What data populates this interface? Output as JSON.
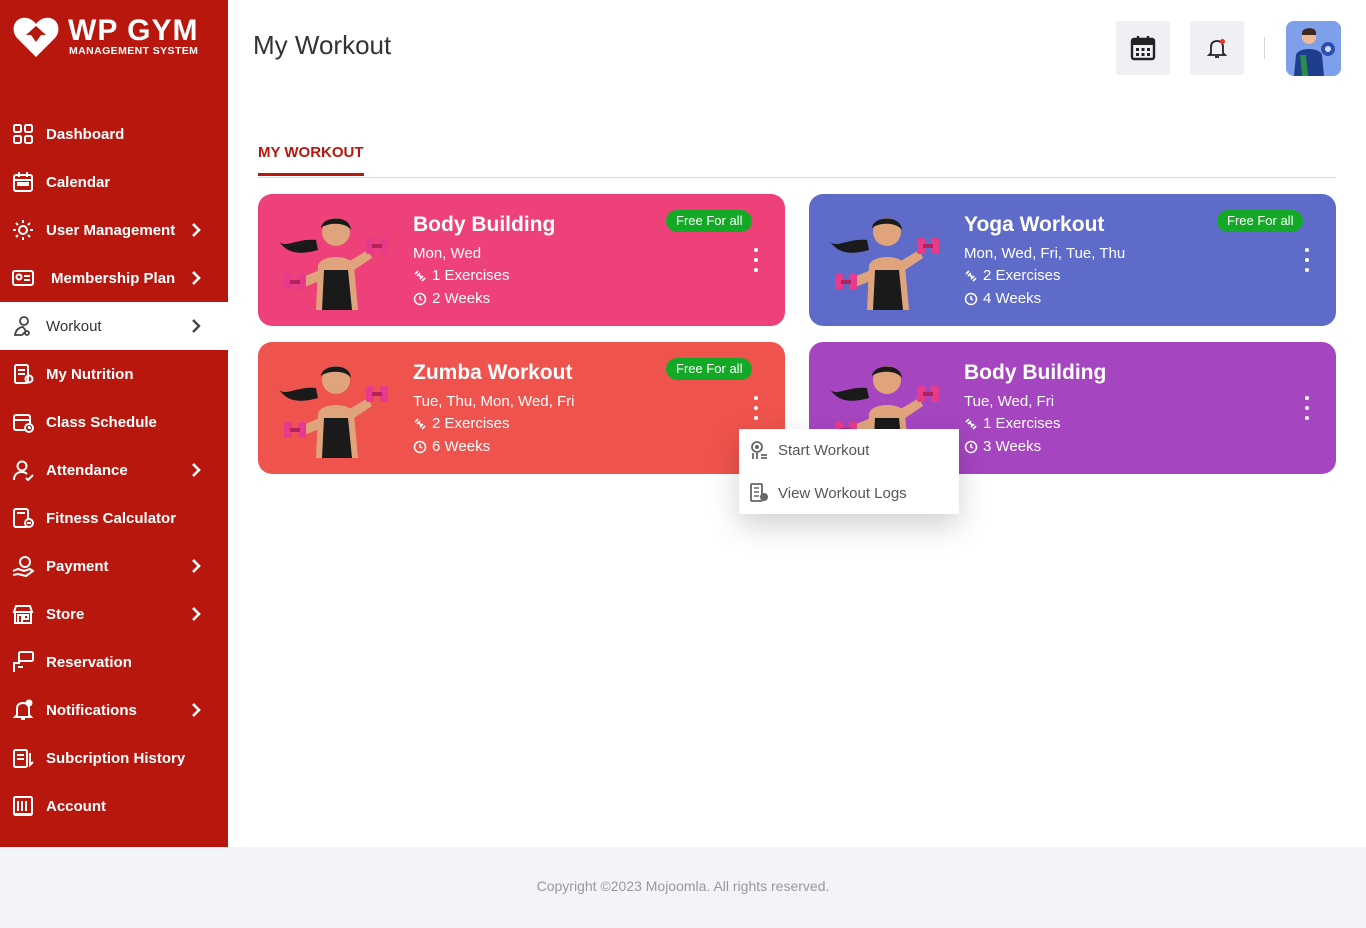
{
  "brand": {
    "title": "WP GYM",
    "subtitle": "MANAGEMENT SYSTEM"
  },
  "sidebar": {
    "items": [
      {
        "label": "Dashboard",
        "icon": "dashboard-grid-icon",
        "has_submenu": false
      },
      {
        "label": "Calendar",
        "icon": "calendar-icon",
        "has_submenu": false
      },
      {
        "label": "User Management",
        "icon": "users-gear-icon",
        "has_submenu": true
      },
      {
        "label": "Membership Plan",
        "icon": "membership-card-icon",
        "has_submenu": true
      },
      {
        "label": "Workout",
        "icon": "workout-icon",
        "has_submenu": true,
        "active": true
      },
      {
        "label": "My Nutrition",
        "icon": "nutrition-icon",
        "has_submenu": false
      },
      {
        "label": "Class Schedule",
        "icon": "class-schedule-icon",
        "has_submenu": false
      },
      {
        "label": "Attendance",
        "icon": "attendance-icon",
        "has_submenu": true
      },
      {
        "label": "Fitness Calculator",
        "icon": "calculator-icon",
        "has_submenu": false
      },
      {
        "label": "Payment",
        "icon": "payment-icon",
        "has_submenu": true
      },
      {
        "label": "Store",
        "icon": "store-icon",
        "has_submenu": true
      },
      {
        "label": "Reservation",
        "icon": "reservation-icon",
        "has_submenu": false
      },
      {
        "label": "Notifications",
        "icon": "bell-icon",
        "has_submenu": true
      },
      {
        "label": "Subcription History",
        "icon": "subscription-history-icon",
        "has_submenu": false
      },
      {
        "label": "Account",
        "icon": "account-icon",
        "has_submenu": false
      }
    ]
  },
  "header": {
    "title": "My Workout"
  },
  "tabs": [
    {
      "label": "MY WORKOUT",
      "active": true
    }
  ],
  "cards": [
    {
      "name": "Body Building",
      "days": "Mon, Wed",
      "exercises": "1 Exercises",
      "duration": "2 Weeks",
      "badge": "Free For all",
      "color": "#ee4179"
    },
    {
      "name": "Yoga Workout",
      "days": "Mon, Wed, Fri, Tue, Thu",
      "exercises": "2 Exercises",
      "duration": "4 Weeks",
      "badge": "Free For all",
      "color": "#5e6bc8"
    },
    {
      "name": "Zumba Workout",
      "days": "Tue, Thu, Mon, Wed, Fri",
      "exercises": "2 Exercises",
      "duration": "6 Weeks",
      "badge": "Free For all",
      "color": "#ef534d"
    },
    {
      "name": "Body Building",
      "days": "Tue, Wed, Fri",
      "exercises": "1 Exercises",
      "duration": "3 Weeks",
      "badge": "",
      "color": "#a645c0"
    }
  ],
  "context_menu": {
    "items": [
      {
        "label": "Start Workout",
        "icon": "start-workout-icon"
      },
      {
        "label": "View Workout Logs",
        "icon": "workout-logs-icon"
      }
    ]
  },
  "footer": {
    "text": "Copyright ©2023 Mojoomla. All rights reserved."
  },
  "colors": {
    "sidebar": "#b8170d",
    "badge": "#14a827",
    "accent": "#b8170d"
  }
}
